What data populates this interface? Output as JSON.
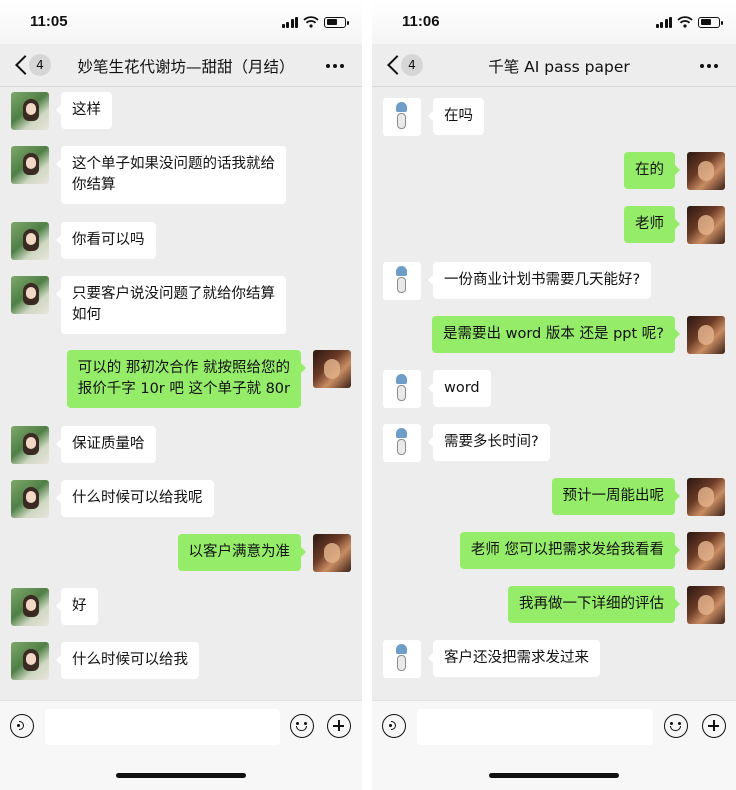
{
  "left": {
    "status": {
      "time": "11:05"
    },
    "header": {
      "unread": "4",
      "title": "妙笔生花代谢坊—甜甜（月结）"
    },
    "messages": [
      {
        "from": "in",
        "lines": [
          "这样"
        ]
      },
      {
        "from": "in",
        "lines": [
          "这个单子如果没问题的话我就给",
          "你结算"
        ]
      },
      {
        "from": "in",
        "lines": [
          "你看可以吗"
        ]
      },
      {
        "from": "in",
        "lines": [
          "只要客户说没问题了就给你结算",
          "如何"
        ]
      },
      {
        "from": "out",
        "lines": [
          "可以的 那初次合作 就按照给您的",
          "报价千字 10r 吧 这个单子就 80r"
        ]
      },
      {
        "from": "in",
        "lines": [
          "保证质量哈"
        ]
      },
      {
        "from": "in",
        "lines": [
          "什么时候可以给我呢"
        ]
      },
      {
        "from": "out",
        "lines": [
          "以客户满意为准"
        ]
      },
      {
        "from": "in",
        "lines": [
          "好"
        ]
      },
      {
        "from": "in",
        "lines": [
          "什么时候可以给我"
        ]
      }
    ]
  },
  "right": {
    "status": {
      "time": "11:06"
    },
    "header": {
      "unread": "4",
      "title": "千笔 AI pass paper"
    },
    "messages": [
      {
        "from": "in",
        "lines": [
          "在吗"
        ]
      },
      {
        "from": "out",
        "lines": [
          "在的"
        ]
      },
      {
        "from": "out",
        "lines": [
          "老师"
        ]
      },
      {
        "from": "in",
        "lines": [
          "一份商业计划书需要几天能好?"
        ]
      },
      {
        "from": "out",
        "lines": [
          "是需要出 word 版本 还是 ppt 呢?"
        ]
      },
      {
        "from": "in",
        "lines": [
          "word"
        ]
      },
      {
        "from": "in",
        "lines": [
          "需要多长时间?"
        ]
      },
      {
        "from": "out",
        "lines": [
          "预计一周能出呢"
        ]
      },
      {
        "from": "out",
        "lines": [
          "老师 您可以把需求发给我看看"
        ]
      },
      {
        "from": "out",
        "lines": [
          "我再做一下详细的评估"
        ]
      },
      {
        "from": "in",
        "lines": [
          "客户还没把需求发过来"
        ]
      }
    ]
  },
  "colors": {
    "outgoing_bubble": "#95ec69",
    "incoming_bubble": "#ffffff",
    "chat_background": "#ededed"
  },
  "icons": [
    "signal-icon",
    "wifi-icon",
    "battery-icon",
    "back-arrow-icon",
    "more-icon",
    "voice-icon",
    "emoji-icon",
    "plus-icon"
  ]
}
